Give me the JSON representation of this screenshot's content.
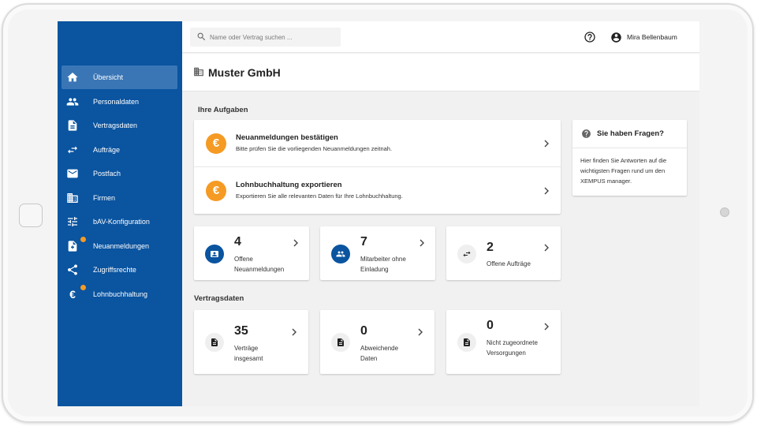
{
  "sidebar": {
    "items": [
      {
        "label": "Übersicht",
        "icon": "home-icon",
        "active": true
      },
      {
        "label": "Personaldaten",
        "icon": "people-icon"
      },
      {
        "label": "Vertragsdaten",
        "icon": "document-icon"
      },
      {
        "label": "Aufträge",
        "icon": "swap-arrows-icon"
      },
      {
        "label": "Postfach",
        "icon": "mail-icon"
      },
      {
        "label": "Firmen",
        "icon": "building-icon"
      },
      {
        "label": "bAV-Konfiguration",
        "icon": "sliders-icon"
      },
      {
        "label": "Neuanmeldungen",
        "icon": "add-document-icon",
        "badge": true
      },
      {
        "label": "Zugriffsrechte",
        "icon": "share-icon"
      },
      {
        "label": "Lohnbuchhaltung",
        "icon": "euro-icon",
        "badge": true
      }
    ]
  },
  "topbar": {
    "search_placeholder": "Name oder Vertrag suchen ...",
    "user_name": "Mira Bellenbaum"
  },
  "page": {
    "title": "Muster GmbH"
  },
  "tasks": {
    "section_title": "Ihre Aufgaben",
    "items": [
      {
        "title": "Neuanmeldungen bestätigen",
        "subtitle": "Bitte prüfen Sie die vorliegenden Neuanmeldungen zeitnah.",
        "icon_glyph": "€"
      },
      {
        "title": "Lohnbuchhaltung exportieren",
        "subtitle": "Exportieren Sie alle relevanten Daten für Ihre Lohnbuchhaltung.",
        "icon_glyph": "€"
      }
    ]
  },
  "task_kpis": [
    {
      "value": "4",
      "label": "Offene Neuanmeldungen"
    },
    {
      "value": "7",
      "label": "Mitarbeiter ohne Einladung"
    },
    {
      "value": "2",
      "label": "Offene Aufträge"
    }
  ],
  "contracts": {
    "section_title": "Vertragsdaten",
    "kpis": [
      {
        "value": "35",
        "label": "Verträge insgesamt"
      },
      {
        "value": "0",
        "label": "Abweichende Daten"
      },
      {
        "value": "0",
        "label": "Nicht zugeordnete Versorgungen"
      }
    ]
  },
  "faq": {
    "title": "Sie haben Fragen?",
    "text": "Hier finden Sie Antworten auf die wichtigsten Fragen rund um den XEMPUS manager."
  },
  "colors": {
    "sidebar": "#0a54a0",
    "sidebar_active": "#3a76b6",
    "accent_orange": "#f59a23",
    "icon_blue": "#0a54a0",
    "icon_grey": "#efefef"
  }
}
